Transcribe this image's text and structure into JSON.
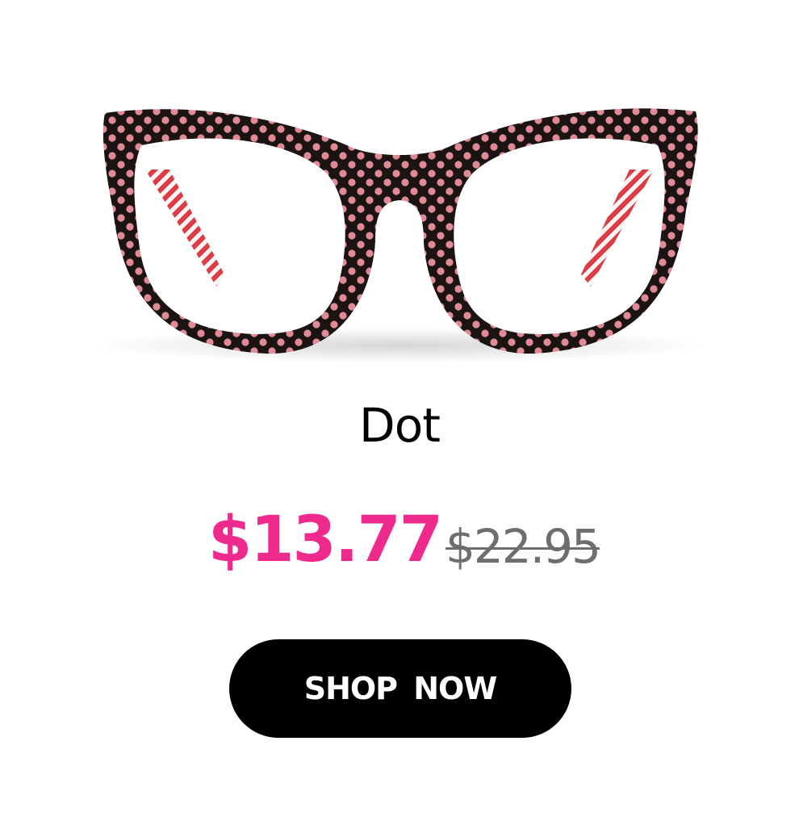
{
  "product": {
    "name": "Dot",
    "image_icon": "polka-dot-cat-eye-glasses",
    "frame_color": "#1c1412",
    "dot_color": "#e08a96",
    "temple_color": "#d8262f"
  },
  "pricing": {
    "sale_price": "$13.77",
    "original_price": "$22.95",
    "sale_color": "#ee2a8c",
    "original_color": "#6e6e6e"
  },
  "cta": {
    "label": "SHOP  NOW",
    "background": "#000000",
    "text_color": "#ffffff"
  }
}
